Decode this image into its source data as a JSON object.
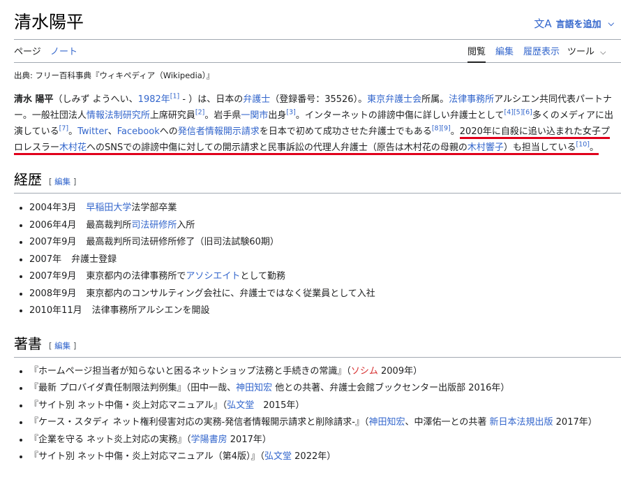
{
  "page": {
    "title": "清水陽平",
    "lang_button": "言語を追加",
    "lang_icon": "translate-icon"
  },
  "tabs": {
    "page": "ページ",
    "note": "ノート",
    "read": "閲覧",
    "edit": "編集",
    "history": "履歴表示",
    "tools": "ツール"
  },
  "source": "出典: フリー百科事典『ウィキペディア（Wikipedia）』",
  "lead": {
    "name": "清水 陽平",
    "t1": "（しみず ようへい、",
    "year_link": "1982年",
    "ref1": "[1]",
    "t2": " - ）は、日本の",
    "bengoshi_link": "弁護士",
    "t3": "（登録番号：35526）。",
    "tokyo_bar_link": "東京弁護士会",
    "t4": "所属。",
    "law_firm_link": "法律事務所",
    "t5": "アルシエン共同代表パートナー。一般社団法人",
    "institute_link": "情報法制研究所",
    "t6": "上席研究員",
    "ref2": "[2]",
    "t7": "。岩手県",
    "ichinoseki_link": "一関市",
    "t8": "出身",
    "ref3": "[3]",
    "t9": "。インターネットの誹謗中傷に詳しい弁護士として",
    "ref456": "[4][5][6]",
    "t10": "多くのメディアに出演している",
    "ref7": "[7]",
    "t11": "。",
    "twitter_link": "Twitter",
    "t12": "、",
    "facebook_link": "Facebook",
    "t13": "への",
    "disclosure_link": "発信者情報開示請求",
    "t14": "を日本で初めて成功させた弁護士でもある",
    "ref89": "[8][9]",
    "t15": "。",
    "u1": "2020年に自殺に追い込まれた女子プロレスラー",
    "kimura_hana_link": "木村花",
    "u2": "へのSNSでの誹謗中傷に対しての開示請求と民事訴訟の代理人弁護士（原告は木村花の母親の",
    "kimura_kyoko_link": "木村響子",
    "u3": "）も担当している",
    "ref10": "[10]",
    "t16": "。"
  },
  "career": {
    "heading": "経歴",
    "edit_open": "[",
    "edit_label": "編集",
    "edit_close": "]",
    "items": [
      {
        "date": "2004年3月",
        "link": "早稲田大学",
        "text": "法学部卒業"
      },
      {
        "date": "2006年4月",
        "pre": "最高裁判所",
        "link": "司法研修所",
        "text": "入所"
      },
      {
        "date": "2007年9月",
        "text": "最高裁判所司法研修所修了（旧司法試験60期）"
      },
      {
        "date": "2007年",
        "text": "弁護士登録"
      },
      {
        "date": "2007年9月",
        "pre": "東京都内の法律事務所で",
        "link": "アソシエイト",
        "text": "として勤務"
      },
      {
        "date": "2008年9月",
        "text": "東京都内のコンサルティング会社に、弁護士ではなく従業員として入社"
      },
      {
        "date": "2010年11月",
        "text": "法律事務所アルシエンを開設"
      }
    ]
  },
  "books": {
    "heading": "著書",
    "edit_label": "編集",
    "items": [
      {
        "t1": "『ホームページ担当者が知らないと困るネットショップ法務と手続きの常識』（",
        "l1": "ソシム",
        "t2": " 2009年）"
      },
      {
        "t1": "『最新 プロバイダ責任制限法判例集』（田中一哉、",
        "l1": "神田知宏",
        "t2": " 他との共著、弁護士会館ブックセンター出版部 2016年）"
      },
      {
        "t1": "『サイト別 ネット中傷・炎上対応マニュアル』（",
        "l1": "弘文堂",
        "t2": "　2015年）"
      },
      {
        "t1": "『ケース・スタディ ネット権利侵害対応の実務-発信者情報開示請求と削除請求-』（",
        "l1": "神田知宏",
        "t2": "、中澤佑一との共著 ",
        "l2": "新日本法規出版",
        "t3": " 2017年）"
      },
      {
        "t1": "『企業を守る ネット炎上対応の実務』（",
        "l1": "学陽書房",
        "t2": " 2017年）"
      },
      {
        "t1": "『サイト別 ネット中傷・炎上対応マニュアル（第4版）』（",
        "l1": "弘文堂",
        "t2": " 2022年）"
      }
    ]
  },
  "colors": {
    "link": "#3366cc",
    "redlink": "#d73333",
    "underline_annotation": "#e0001b"
  }
}
